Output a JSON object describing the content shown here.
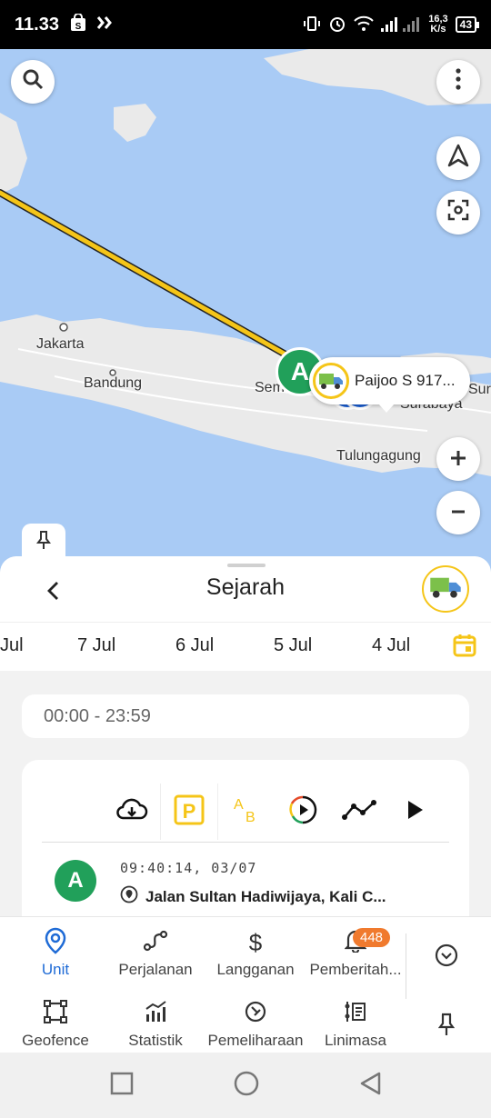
{
  "status": {
    "time": "11.33",
    "speed_value": "16,3",
    "speed_unit": "K/s",
    "battery": "43"
  },
  "map": {
    "labels": [
      "Jakarta",
      "Bandung",
      "Semarang",
      "Surabaya",
      "Sur",
      "Tulungagung"
    ],
    "vehicle_callout": "Paijoo S 917...",
    "start_marker": "A",
    "parking_marker": "P"
  },
  "sheet": {
    "title": "Sejarah",
    "dates": [
      "Jul",
      "7 Jul",
      "6 Jul",
      "5 Jul",
      "4 Jul"
    ],
    "time_range": "00:00 - 23:59",
    "stop": {
      "marker": "A",
      "time": "09:40:14, 03/07",
      "address": "Jalan Sultan Hadiwijaya, Kali C..."
    }
  },
  "nav": {
    "row1": [
      {
        "label": "Unit",
        "icon": "location-pin-icon"
      },
      {
        "label": "Perjalanan",
        "icon": "route-icon"
      },
      {
        "label": "Langganan",
        "icon": "dollar-icon"
      },
      {
        "label": "Pemberitah...",
        "icon": "bell-icon",
        "badge": "448"
      }
    ],
    "row2": [
      {
        "label": "Geofence",
        "icon": "geofence-icon"
      },
      {
        "label": "Statistik",
        "icon": "stats-icon"
      },
      {
        "label": "Pemeliharaan",
        "icon": "maintenance-icon"
      },
      {
        "label": "Linimasa",
        "icon": "timeline-icon"
      }
    ]
  },
  "colors": {
    "accent_blue": "#1f6bd6",
    "route_yellow": "#f5c518",
    "start_green": "#21a05a",
    "badge_orange": "#f07a2e"
  }
}
